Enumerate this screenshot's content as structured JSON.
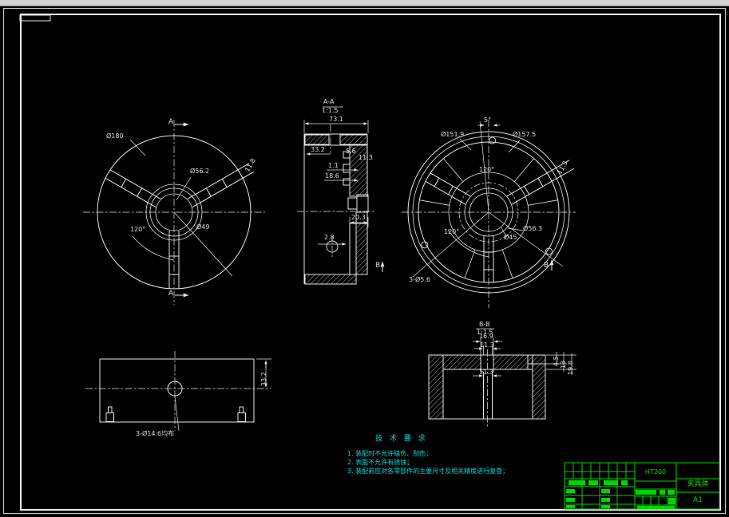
{
  "colors": {
    "background": "#000000",
    "linework": "#e8e8e8",
    "dimension_text": "#dedede",
    "tech_notes": "#00dede",
    "title_block": "#00d400",
    "window_strip": "#d2d2d2"
  },
  "views": {
    "front": {
      "d_outer": "Ø180",
      "d_bore": "Ø56.2",
      "d_inner": "Ø49",
      "angle": "120°",
      "slot_width": "11.8",
      "section_label_top": "A",
      "section_label_bottom": "A"
    },
    "section_a": {
      "title": "A-A",
      "scale": "1:1.5",
      "width": "73.1",
      "dim_33_2": "33.2",
      "dim_5_6": "5.6",
      "dim_11_3": "11.3",
      "dim_1_1": "1.1",
      "dim_18_6": "18.6",
      "dim_20_3": "20.3",
      "dim_2_8": "2.8",
      "view_mark": "B"
    },
    "side": {
      "d_ring_inner": "Ø151.9",
      "d_ring_outer": "Ø157.5",
      "angle_5": "5°",
      "angle_top": "120°",
      "angle_left": "120°",
      "d_hub": "Ø56.3",
      "d_bore": "Ø45",
      "holes": "3-Ø5.6",
      "slot_width": "11.3",
      "view_mark": "B"
    },
    "bottom": {
      "holes": "3-Ø14.6均布",
      "height": "33.2"
    },
    "section_b": {
      "title": "B-B",
      "scale": "1:1.5",
      "dim_16_9": "16.9",
      "dim_11_3_top": "11.3",
      "dim_11_3_bot": "11.3",
      "dim_4_5": "4.5",
      "dim_13": "13",
      "dim_19_8": "19.8"
    }
  },
  "tech_requirements": {
    "title": "技 术 要 求",
    "items": [
      "1. 装配时不允许磕伤、刮伤；",
      "2. 表面不允许有锈蚀；",
      "3. 装配前应对各零部件的主要尺寸及相关精度进行复查；"
    ]
  },
  "title_block": {
    "material": "HT200",
    "part_name": "夹具体",
    "sheet_size": "A1"
  }
}
